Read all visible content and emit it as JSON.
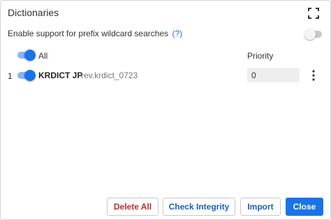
{
  "dialog": {
    "title": "Dictionaries",
    "fullscreen_icon": "fullscreen-icon"
  },
  "prefix_wildcard": {
    "label": "Enable support for prefix wildcard searches",
    "help": "(?)",
    "enabled": false
  },
  "table": {
    "all_label": "All",
    "all_enabled": true,
    "priority_header": "Priority",
    "rows": [
      {
        "index": "1",
        "enabled": true,
        "name": "KRDICT JP",
        "revision": "rev.krdict_0723",
        "priority": "0",
        "menu_icon": "more-vertical-icon"
      }
    ]
  },
  "footer": {
    "delete_all": "Delete All",
    "check_integrity": "Check Integrity",
    "import": "Import",
    "close": "Close"
  },
  "colors": {
    "accent": "#1a73e8",
    "danger": "#c62828",
    "link": "#1a5fb4"
  }
}
